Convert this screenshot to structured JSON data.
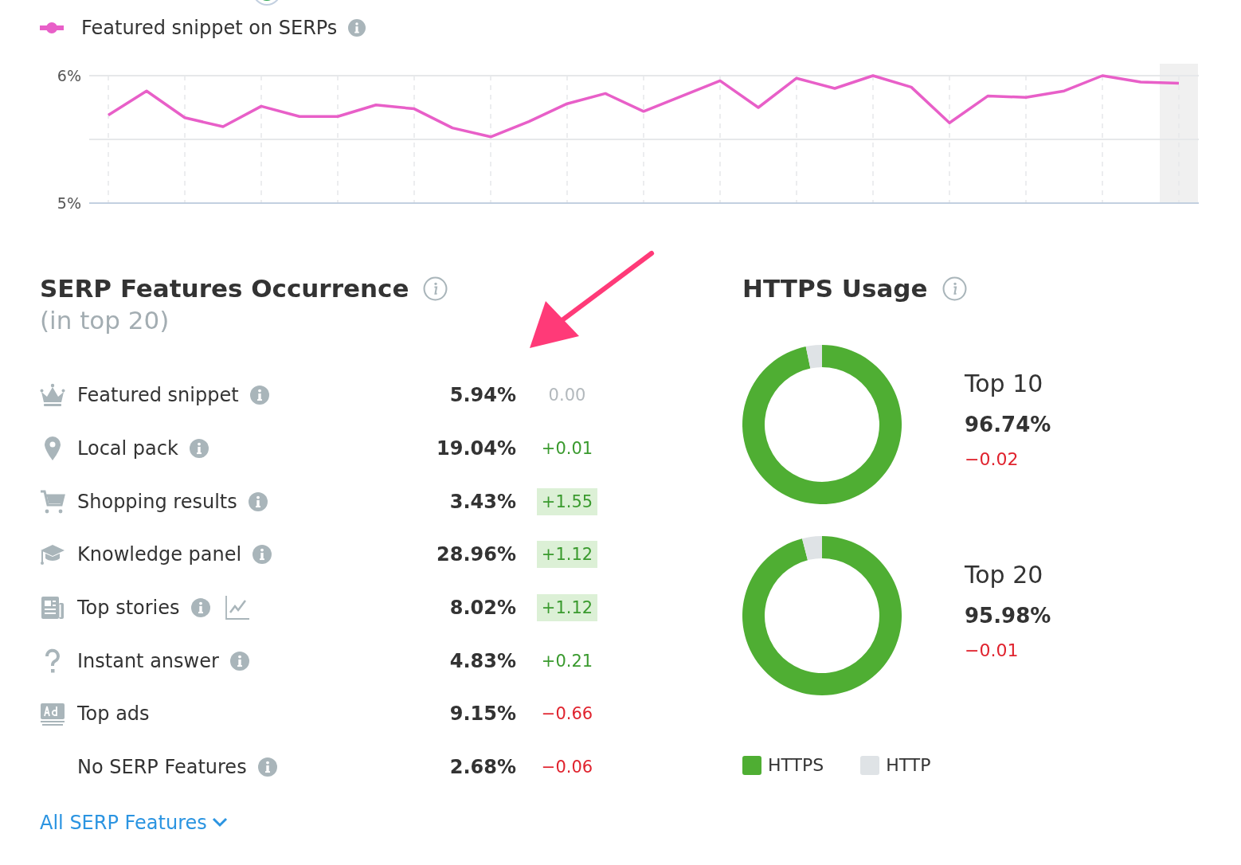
{
  "trend_chart": {
    "info": true,
    "chart_data": {
      "type": "line",
      "grid": true,
      "ylim": [
        5,
        6
      ],
      "ref_lines": [
        {
          "axis": "y",
          "value": 5.5
        }
      ],
      "yticks": [
        {
          "value": 5,
          "label": "5%"
        },
        {
          "value": 6,
          "label": "6%"
        }
      ],
      "series": [
        {
          "name": "Featured snippet on SERPs",
          "color": "#e85fc8",
          "values": [
            5.69,
            5.88,
            5.67,
            5.6,
            5.76,
            5.68,
            5.68,
            5.77,
            5.74,
            5.59,
            5.52,
            5.64,
            5.78,
            5.86,
            5.72,
            5.84,
            5.96,
            5.75,
            5.98,
            5.9,
            6.0,
            5.91,
            5.63,
            5.84,
            5.83,
            5.88,
            6.0,
            5.95,
            5.94
          ]
        }
      ]
    }
  },
  "serp_features": {
    "title": "SERP Features Occurrence",
    "subtitle": "(in top 20)",
    "info": true,
    "rows": [
      {
        "kind": "crown",
        "label": "Featured snippet",
        "info": true,
        "chart": false,
        "value": "5.94%",
        "change": "0.00",
        "color": "#b3b9bd",
        "highlighted": false
      },
      {
        "kind": "pin",
        "label": "Local pack",
        "info": true,
        "chart": false,
        "value": "19.04%",
        "change": "+0.01",
        "color": "#3a9a2e",
        "highlighted": false
      },
      {
        "kind": "cart",
        "label": "Shopping results",
        "info": true,
        "chart": false,
        "value": "3.43%",
        "change": "+1.55",
        "color": "#3a9a2e",
        "highlighted": true
      },
      {
        "kind": "cap",
        "label": "Knowledge panel",
        "info": true,
        "chart": false,
        "value": "28.96%",
        "change": "+1.12",
        "color": "#3a9a2e",
        "highlighted": true
      },
      {
        "kind": "news",
        "label": "Top stories",
        "info": true,
        "chart": true,
        "value": "8.02%",
        "change": "+1.12",
        "color": "#3a9a2e",
        "highlighted": true
      },
      {
        "kind": "question",
        "label": "Instant answer",
        "info": true,
        "chart": false,
        "value": "4.83%",
        "change": "+0.21",
        "color": "#3a9a2e",
        "highlighted": false
      },
      {
        "kind": "ad",
        "label": "Top ads",
        "info": false,
        "chart": false,
        "value": "9.15%",
        "change": "−0.66",
        "color": "#e0232e",
        "highlighted": false
      },
      {
        "kind": "none",
        "label": "No SERP Features",
        "info": true,
        "chart": false,
        "value": "2.68%",
        "change": "−0.06",
        "color": "#e0232e",
        "highlighted": false
      }
    ],
    "link": "All SERP Features"
  },
  "https_usage": {
    "title": "HTTPS Usage",
    "info": true,
    "donuts": [
      {
        "value": "96.74%",
        "change": "−0.02",
        "color": "#e0232e",
        "chart_data": {
          "type": "donut",
          "series": [
            {
              "name": "Top 10",
              "values": [
                96.74,
                3.26
              ]
            }
          ]
        }
      },
      {
        "value": "95.98%",
        "change": "−0.01",
        "color": "#e0232e",
        "chart_data": {
          "type": "donut",
          "series": [
            {
              "name": "Top 20",
              "values": [
                95.98,
                4.02
              ]
            }
          ]
        }
      }
    ],
    "legend": [
      {
        "label": "HTTPS",
        "color": "#4fae33"
      },
      {
        "label": "HTTP",
        "color": "#dfe3e6"
      }
    ]
  }
}
